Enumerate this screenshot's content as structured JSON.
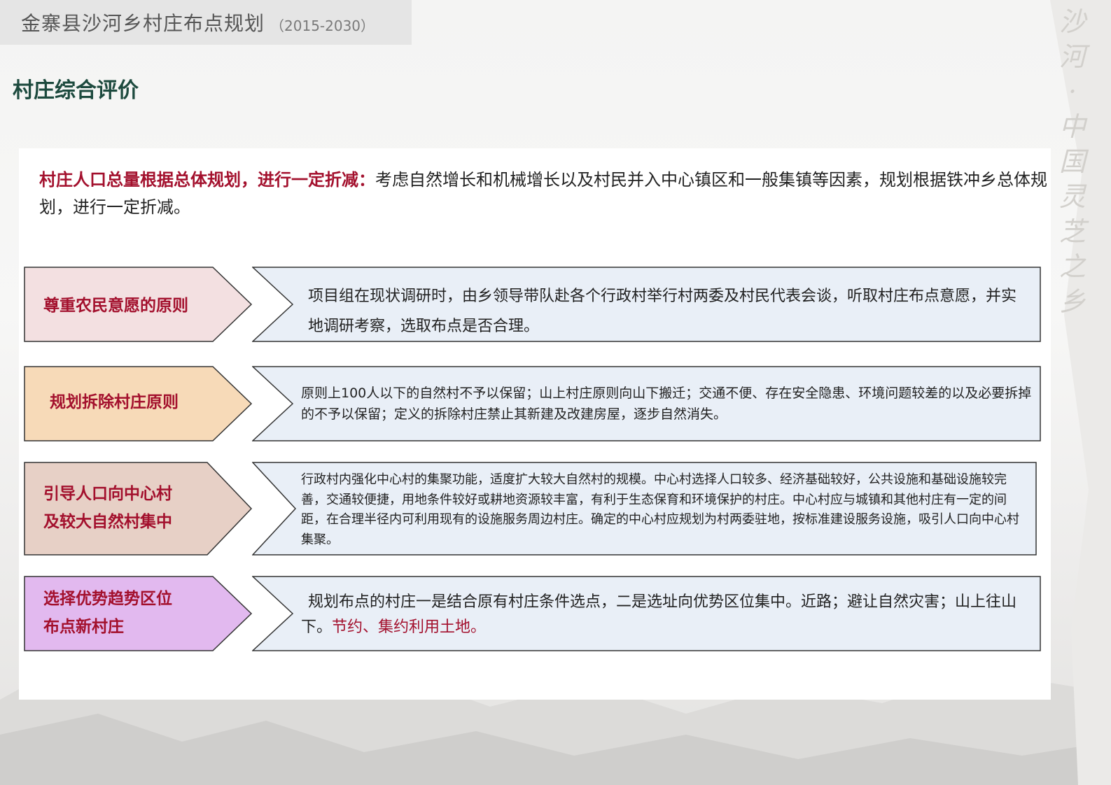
{
  "header": {
    "title": "金寨县沙河乡村庄布点规划",
    "year": "（2015-2030）"
  },
  "vertical_slogan": [
    "沙",
    "河",
    "·",
    "中",
    "国",
    "灵",
    "芝",
    "之",
    "乡"
  ],
  "section_title": "村庄综合评价",
  "intro": {
    "emphasis": "村庄人口总量根据总体规划，进行一定折减：",
    "text": "考虑自然增长和机械增长以及村民并入中心镇区和一般集镇等因素，规划根据铁冲乡总体规划，进行一定折减。"
  },
  "principles": [
    {
      "label": "尊重农民意愿的原则",
      "desc": "项目组在现状调研时，由乡领导带队赴各个行政村举行村两委及村民代表会谈，听取村庄布点意愿，并实地调研考察，选取布点是否合理。",
      "label_color": "#f3e0e1"
    },
    {
      "label": "规划拆除村庄原则",
      "desc": "原则上100人以下的自然村不予以保留；山上村庄原则向山下搬迁；交通不便、存在安全隐患、环境问题较差的以及必要拆掉的不予以保留；定义的拆除村庄禁止其新建及改建房屋，逐步自然消失。",
      "label_color": "#f7dab8"
    },
    {
      "label_line1": "引导人口向中心村",
      "label_line2": "及较大自然村集中",
      "desc": "行政村内强化中心村的集聚功能，适度扩大较大自然村的规模。中心村选择人口较多、经济基础较好，公共设施和基础设施较完善，交通较便捷，用地条件较好或耕地资源较丰富，有利于生态保育和环境保护的村庄。中心村应与城镇和其他村庄有一定的间距，在合理半径内可利用现有的设施服务周边村庄。确定的中心村应规划为村两委驻地，按标准建设服务设施，吸引人口向中心村集聚。",
      "label_color": "#e7d0c6"
    },
    {
      "label_line1": "选择优势趋势区位",
      "label_line2": "布点新村庄",
      "desc": "规划布点的村庄一是结合原有村庄条件选点，二是选址向优势区位集中。近路；避让自然灾害；山上往山下。",
      "desc_emphasis": "节约、集约利用土地。",
      "label_color": "#e2b9ef"
    }
  ],
  "colors": {
    "accent_red": "#a3102d",
    "title_green": "#1d4a3e",
    "desc_fill": "#e9eff7"
  }
}
